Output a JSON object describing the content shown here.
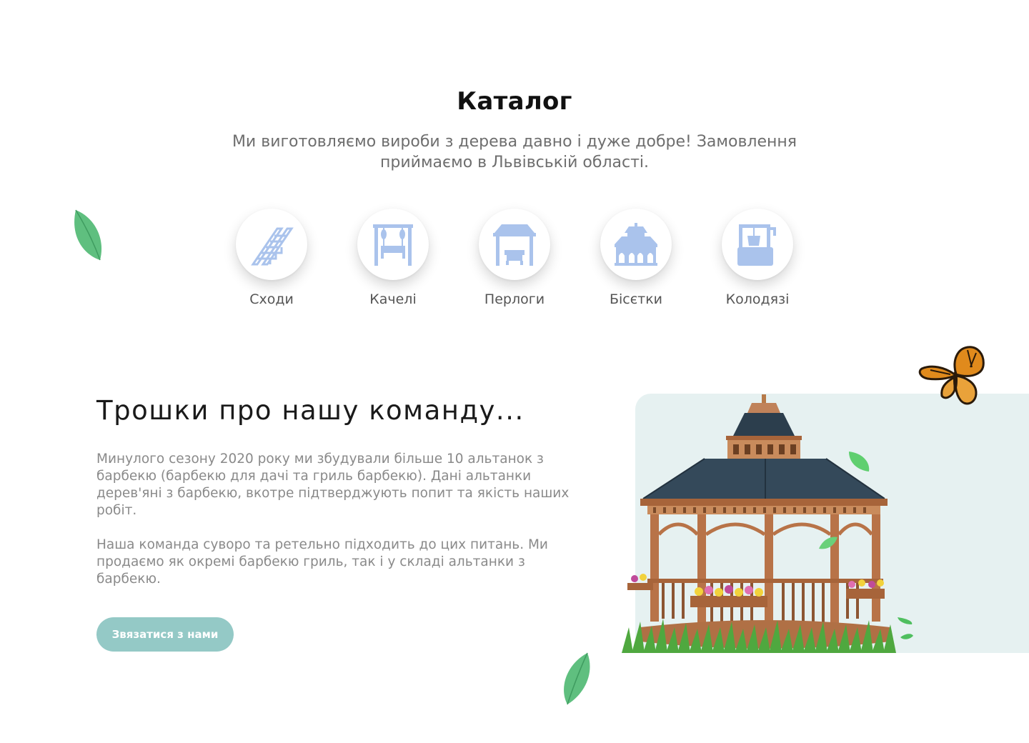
{
  "catalog": {
    "title": "Каталог",
    "subtitle": "Ми виготовляємо вироби з дерева давно і дуже добре! Замовлення приймаємо в Львівській області.",
    "categories": [
      {
        "label": "Сходи",
        "icon": "stairs-icon"
      },
      {
        "label": "Качелі",
        "icon": "swing-icon"
      },
      {
        "label": "Перлоги",
        "icon": "pergola-icon"
      },
      {
        "label": "Бісєтки",
        "icon": "gazebo-icon"
      },
      {
        "label": "Колодязі",
        "icon": "well-icon"
      }
    ]
  },
  "team": {
    "title": "Трошки про нашу команду...",
    "paragraph1": "Минулого сезону 2020 року ми збудували більше 10 альтанок з барбекю (барбекю для дачі та гриль барбекю). Дані альтанки дерев'яні з барбекю, вкотре підтверджують попит та якість наших робіт.",
    "paragraph2": "Наша команда суворо та ретельно підходить до цих питань. Ми продаємо як окремі барбекю гриль, так і у складі альтанки з барбекю.",
    "button_label": "Звязатися з нами"
  },
  "colors": {
    "icon": "#aac3ec",
    "button": "#94c9c6",
    "panel": "#e6f1f1",
    "leaf": "#5fbf7f"
  }
}
